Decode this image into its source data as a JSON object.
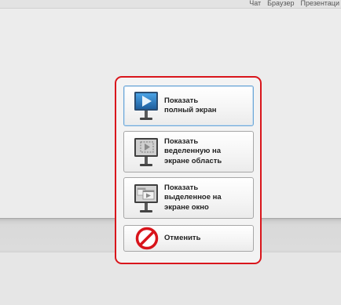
{
  "topbar": {
    "tabs": [
      "Чат",
      "Браузер",
      "Презентаци"
    ]
  },
  "menu": {
    "items": [
      {
        "label": "Показать\nполный экран",
        "icon": "monitor-fullscreen-icon",
        "active": true
      },
      {
        "label": "Показать\nведеленную на\nэкране область",
        "icon": "monitor-region-icon",
        "active": false
      },
      {
        "label": "Показать\nвыделенное на\nэкране окно",
        "icon": "monitor-window-icon",
        "active": false
      },
      {
        "label": "Отменить",
        "icon": "cancel-stop-icon",
        "active": false
      }
    ]
  },
  "colors": {
    "highlight_frame": "#d9161c",
    "active_border": "#6ea8d8",
    "cancel_red": "#d8141b",
    "monitor_blue": "#2f7fc8"
  }
}
